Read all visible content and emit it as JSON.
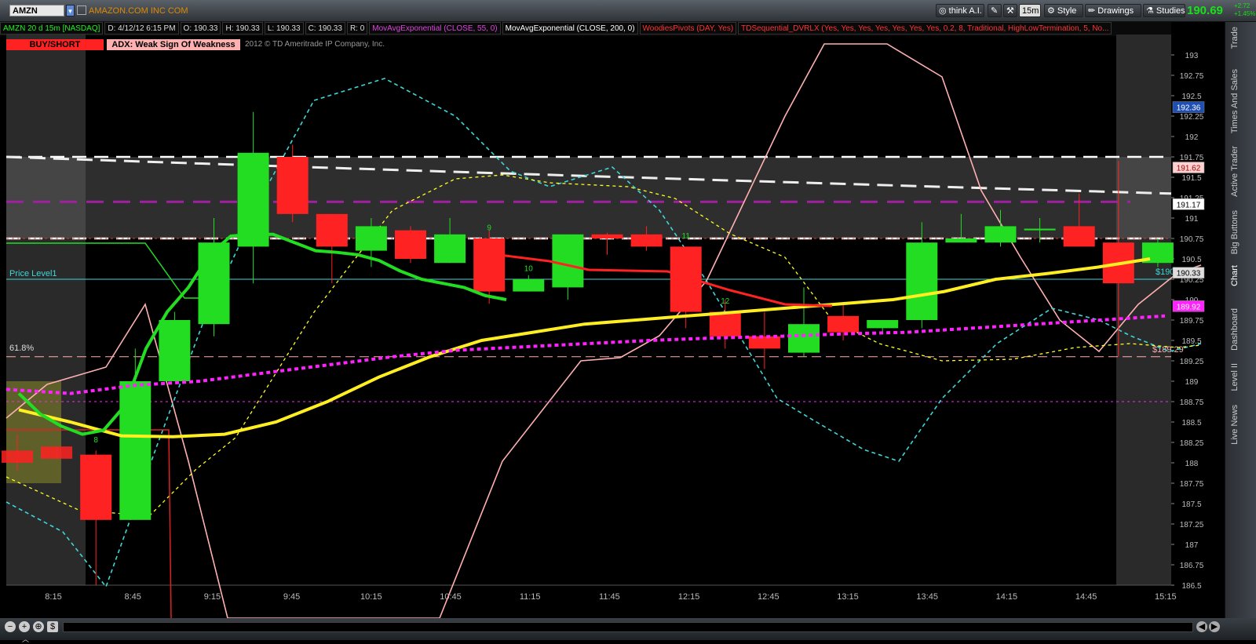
{
  "header": {
    "symbol": "AMZN",
    "company": "AMAZON.COM INC COM",
    "think_label": "think A.I.",
    "interval_label": "15m",
    "style_label": "Style",
    "drawings_label": "Drawings",
    "studies_label": "Studies",
    "last_price": "190.69",
    "net_change": "+2.72",
    "pct_change": "+1.45%"
  },
  "status": {
    "chart_id": "AMZN 20 d 15m [NASDAQ]",
    "date": "D: 4/12/12 6:15 PM",
    "open": "O: 190.33",
    "high": "H: 190.33",
    "low": "L: 190.33",
    "close": "C: 190.33",
    "range": "R: 0",
    "study1": "MovAvgExponential (CLOSE, 55, 0)",
    "study2": "MovAvgExponential (CLOSE, 200, 0)",
    "study3": "WoodiesPivots (DAY, Yes)",
    "study4": "TDSequential_DVRLX (Yes, Yes, Yes, Yes, Yes, Yes, Yes, 0.2, 8, Traditional, HighLowTermination, 5, No..."
  },
  "signals": {
    "buy_short": "BUY/SHORT",
    "adx": "ADX: Weak Sign Of Weakness",
    "copyright": "2012 © TD Ameritrade IP Company, Inc."
  },
  "sidebar_tabs": [
    "Trade",
    "Times And Sales",
    "Active Trader",
    "Big Buttons",
    "Chart",
    "Dashboard",
    "Level II",
    "Live News"
  ],
  "colors": {
    "up": "#22dd22",
    "down": "#ff2222",
    "ema55": "#22dd22",
    "ema200": "#ffff22",
    "pivot": "#ff22ff"
  },
  "chart_data": {
    "type": "candlestick",
    "ylim": [
      186.5,
      193.25
    ],
    "y_ticks": [
      "193",
      "192.75",
      "192.5",
      "192.25",
      "192",
      "191.75",
      "191.5",
      "191.25",
      "191",
      "190.75",
      "190.5",
      "190.25",
      "190",
      "189.75",
      "189.5",
      "189.25",
      "189",
      "188.75",
      "188.5",
      "188.25",
      "188",
      "187.75",
      "187.5",
      "187.25",
      "187",
      "186.75",
      "186.5"
    ],
    "x_ticks": [
      "8:15",
      "8:45",
      "9:15",
      "9:45",
      "10:15",
      "10:45",
      "11:15",
      "11:45",
      "12:15",
      "12:45",
      "13:15",
      "13:45",
      "14:15",
      "14:45",
      "15:15"
    ],
    "candles": [
      {
        "o": 188.15,
        "h": 188.35,
        "l": 187.9,
        "c": 188.0
      },
      {
        "o": 188.2,
        "h": 188.2,
        "l": 188.05,
        "c": 188.05
      },
      {
        "o": 188.1,
        "h": 188.15,
        "l": 186.5,
        "c": 187.3
      },
      {
        "o": 187.3,
        "h": 189.4,
        "l": 187.3,
        "c": 189.0
      },
      {
        "o": 189.0,
        "h": 189.85,
        "l": 189.0,
        "c": 189.75
      },
      {
        "o": 189.7,
        "h": 191.0,
        "l": 189.55,
        "c": 190.7
      },
      {
        "o": 190.65,
        "h": 192.3,
        "l": 190.2,
        "c": 191.8
      },
      {
        "o": 191.75,
        "h": 191.9,
        "l": 190.95,
        "c": 191.05
      },
      {
        "o": 191.05,
        "h": 191.05,
        "l": 190.2,
        "c": 190.65
      },
      {
        "o": 190.6,
        "h": 191.0,
        "l": 190.4,
        "c": 190.9
      },
      {
        "o": 190.85,
        "h": 190.9,
        "l": 190.45,
        "c": 190.5
      },
      {
        "o": 190.45,
        "h": 191.0,
        "l": 190.45,
        "c": 190.8
      },
      {
        "o": 190.75,
        "h": 190.85,
        "l": 189.95,
        "c": 190.1
      },
      {
        "o": 190.1,
        "h": 190.3,
        "l": 190.1,
        "c": 190.25
      },
      {
        "o": 190.15,
        "h": 190.8,
        "l": 190.0,
        "c": 190.8
      },
      {
        "o": 190.8,
        "h": 190.82,
        "l": 190.55,
        "c": 190.75
      },
      {
        "o": 190.8,
        "h": 190.9,
        "l": 190.6,
        "c": 190.65
      },
      {
        "o": 190.65,
        "h": 190.65,
        "l": 189.65,
        "c": 189.85
      },
      {
        "o": 189.85,
        "h": 190.0,
        "l": 189.4,
        "c": 189.55
      },
      {
        "o": 189.55,
        "h": 189.85,
        "l": 189.15,
        "c": 189.4
      },
      {
        "o": 189.35,
        "h": 190.15,
        "l": 189.3,
        "c": 189.7
      },
      {
        "o": 189.8,
        "h": 189.95,
        "l": 189.5,
        "c": 189.6
      },
      {
        "o": 189.65,
        "h": 189.75,
        "l": 189.6,
        "c": 189.75
      },
      {
        "o": 189.75,
        "h": 190.95,
        "l": 189.65,
        "c": 190.7
      },
      {
        "o": 190.7,
        "h": 191.05,
        "l": 190.7,
        "c": 190.75
      },
      {
        "o": 190.7,
        "h": 191.1,
        "l": 190.65,
        "c": 190.9
      },
      {
        "o": 190.85,
        "h": 191.0,
        "l": 190.7,
        "c": 190.87
      },
      {
        "o": 190.9,
        "h": 191.3,
        "l": 190.65,
        "c": 190.65
      },
      {
        "o": 190.7,
        "h": 191.7,
        "l": 189.3,
        "c": 190.2
      },
      {
        "o": 190.45,
        "h": 190.75,
        "l": 190.4,
        "c": 190.7
      }
    ],
    "ema55": [
      188.85,
      188.6,
      188.45,
      188.35,
      188.4,
      188.7,
      189.4,
      189.85,
      190.15,
      190.55,
      190.78,
      190.8,
      190.8,
      190.7,
      190.6,
      190.58,
      190.55,
      190.48,
      190.35,
      190.25,
      190.2,
      190.15,
      190.05,
      190.0
    ],
    "ema200": [
      188.65,
      188.5,
      188.33,
      188.32,
      188.35,
      188.5,
      188.75,
      189.05,
      189.3,
      189.5,
      189.6,
      189.7,
      189.75,
      189.8,
      189.85,
      189.9,
      189.95,
      190.0,
      190.1,
      190.25,
      190.32,
      190.4,
      190.5
    ],
    "pivot_line": [
      188.9,
      188.85,
      188.95,
      189.0,
      189.1,
      189.2,
      189.3,
      189.38,
      189.42,
      189.46,
      189.5,
      189.53,
      189.55,
      189.58,
      189.6,
      189.65,
      189.7,
      189.75,
      189.8
    ],
    "resistance_top": 191.75,
    "resistance_line": 191.4,
    "magenta_dash": 191.2,
    "zone_bottom": 190.75,
    "price_level": 190.25,
    "fib_level": 189.3,
    "support_dash": 188.75,
    "labels": {
      "price_level": "Price Level1",
      "fib": "61.8%",
      "price_tag": "$190.2",
      "low_tag": "$189.29"
    },
    "axis_tags": [
      {
        "value": 192.36,
        "text": "192.36",
        "bg": "#1f4fb3",
        "fg": "#fff"
      },
      {
        "value": 191.62,
        "text": "191.62",
        "bg": "#ffd0d0",
        "fg": "#900"
      },
      {
        "value": 191.17,
        "text": "191.17",
        "bg": "#fff",
        "fg": "#000"
      },
      {
        "value": 190.33,
        "text": "190.33",
        "bg": "#ddd",
        "fg": "#000"
      },
      {
        "value": 189.92,
        "text": "189.92",
        "bg": "#ff22ff",
        "fg": "#fff"
      }
    ],
    "td_counts": [
      {
        "idx": 2,
        "price": 188.25,
        "text": "8"
      },
      {
        "idx": 12,
        "price": 190.85,
        "text": "9"
      },
      {
        "idx": 13,
        "price": 190.35,
        "text": "10"
      },
      {
        "idx": 17,
        "price": 190.75,
        "text": "11"
      },
      {
        "idx": 18,
        "price": 189.95,
        "text": "12"
      }
    ]
  }
}
